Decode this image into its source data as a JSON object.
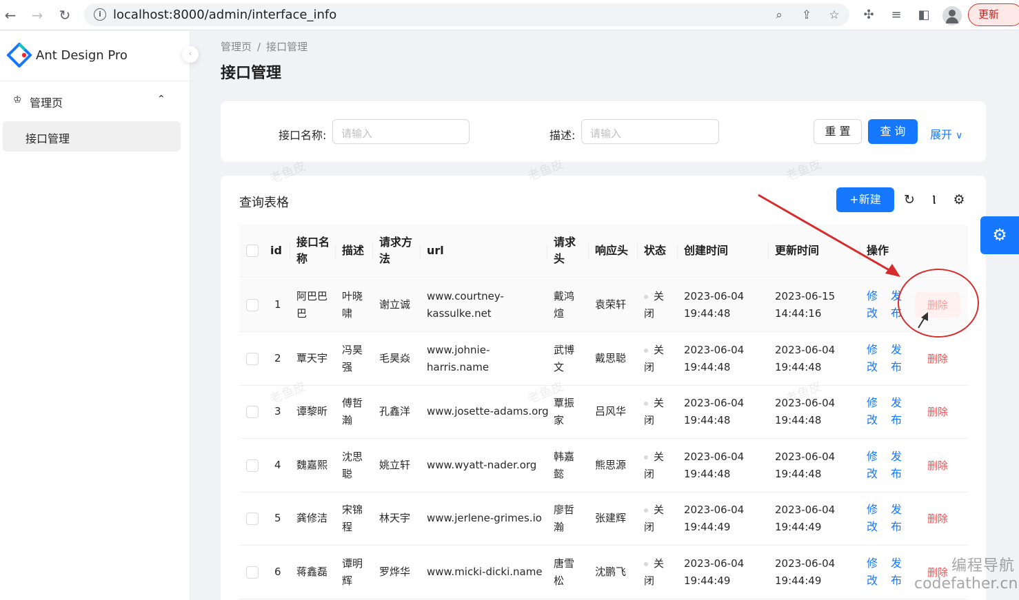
{
  "browser": {
    "url": "localhost:8000/admin/interface_info",
    "update_label": "更新"
  },
  "sidebar": {
    "app_name": "Ant Design Pro",
    "group_label": "管理页",
    "item_label": "接口管理"
  },
  "breadcrumb": {
    "root": "管理页",
    "current": "接口管理"
  },
  "page": {
    "title": "接口管理"
  },
  "search": {
    "name_label": "接口名称:",
    "name_placeholder": "请输入",
    "desc_label": "描述:",
    "desc_placeholder": "请输入",
    "reset_label": "重 置",
    "query_label": "查 询",
    "expand_label": "展开"
  },
  "table": {
    "title": "查询表格",
    "new_label": "新建",
    "columns": {
      "id": "id",
      "name_1": "接口名",
      "name_2": "称",
      "desc": "描述",
      "method_1": "请求方",
      "method_2": "法",
      "url": "url",
      "reqhead_1": "请求",
      "reqhead_2": "头",
      "resphead": "响应头",
      "status": "状态",
      "created": "创建时间",
      "updated": "更新时间",
      "actions": "操作"
    },
    "action_labels": {
      "edit_1": "修",
      "edit_2": "改",
      "publish_1": "发",
      "publish_2": "布",
      "delete": "删除"
    },
    "rows": [
      {
        "id": "1",
        "name_1": "阿巴巴",
        "name_2": "巴",
        "desc_1": "叶晓",
        "desc_2": "啸",
        "method": "谢立诚",
        "url_1": "www.courtney-",
        "url_2": "kassulke.net",
        "req_1": "戴鸿",
        "req_2": "煊",
        "resp": "袁荣轩",
        "status_1": "关",
        "status_2": "闭",
        "created_1": "2023-06-04",
        "created_2": "19:44:48",
        "updated_1": "2023-06-15",
        "updated_2": "14:44:16"
      },
      {
        "id": "2",
        "name_1": "覃天宇",
        "name_2": "",
        "desc_1": "冯昊",
        "desc_2": "强",
        "method": "毛昊焱",
        "url_1": "www.johnie-",
        "url_2": "harris.name",
        "req_1": "武博",
        "req_2": "文",
        "resp": "戴思聪",
        "status_1": "关",
        "status_2": "闭",
        "created_1": "2023-06-04",
        "created_2": "19:44:48",
        "updated_1": "2023-06-04",
        "updated_2": "19:44:48"
      },
      {
        "id": "3",
        "name_1": "谭黎昕",
        "name_2": "",
        "desc_1": "傅哲",
        "desc_2": "瀚",
        "method": "孔鑫洋",
        "url_1": "www.josette-adams.org",
        "url_2": "",
        "req_1": "覃振",
        "req_2": "家",
        "resp": "吕风华",
        "status_1": "关",
        "status_2": "闭",
        "created_1": "2023-06-04",
        "created_2": "19:44:48",
        "updated_1": "2023-06-04",
        "updated_2": "19:44:48"
      },
      {
        "id": "4",
        "name_1": "魏嘉熙",
        "name_2": "",
        "desc_1": "沈思",
        "desc_2": "聪",
        "method": "姚立轩",
        "url_1": "www.wyatt-nader.org",
        "url_2": "",
        "req_1": "韩嘉",
        "req_2": "懿",
        "resp": "熊思源",
        "status_1": "关",
        "status_2": "闭",
        "created_1": "2023-06-04",
        "created_2": "19:44:48",
        "updated_1": "2023-06-04",
        "updated_2": "19:44:48"
      },
      {
        "id": "5",
        "name_1": "龚修洁",
        "name_2": "",
        "desc_1": "宋锦",
        "desc_2": "程",
        "method": "林天宇",
        "url_1": "www.jerlene-grimes.io",
        "url_2": "",
        "req_1": "廖哲",
        "req_2": "瀚",
        "resp": "张建辉",
        "status_1": "关",
        "status_2": "闭",
        "created_1": "2023-06-04",
        "created_2": "19:44:49",
        "updated_1": "2023-06-04",
        "updated_2": "19:44:49"
      },
      {
        "id": "6",
        "name_1": "蒋鑫磊",
        "name_2": "",
        "desc_1": "谭明",
        "desc_2": "辉",
        "method": "罗烨华",
        "url_1": "www.micki-dicki.name",
        "url_2": "",
        "req_1": "唐雪",
        "req_2": "松",
        "resp": "沈鹏飞",
        "status_1": "关",
        "status_2": "闭",
        "created_1": "2023-06-04",
        "created_2": "19:44:49",
        "updated_1": "2023-06-04",
        "updated_2": "19:44:49"
      }
    ]
  },
  "watermark_text": "老鱼皮",
  "site_brand": {
    "cn": "编程导航",
    "en": "codefather.cn"
  }
}
